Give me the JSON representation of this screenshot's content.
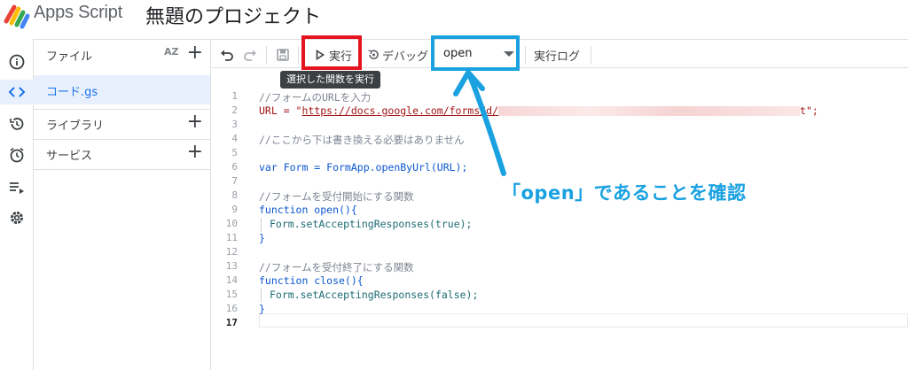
{
  "app": {
    "name": "Apps Script",
    "project_title": "無題のプロジェクト"
  },
  "sidebar": {
    "files_label": "ファイル",
    "sort_label": "AZ",
    "file_name": "コード.gs",
    "libraries_label": "ライブラリ",
    "services_label": "サービス",
    "add_symbol": "+"
  },
  "toolbar": {
    "run_label": "実行",
    "debug_label": "デバッグ",
    "function_select": "open",
    "log_label": "実行ログ",
    "tooltip": "選択した関数を実行"
  },
  "editor": {
    "line_numbers": [
      "1",
      "2",
      "3",
      "4",
      "5",
      "6",
      "7",
      "8",
      "9",
      "10",
      "11",
      "12",
      "13",
      "14",
      "15",
      "16",
      "17"
    ],
    "current_line": "17",
    "line1": "//フォームのURLを入力",
    "line2_prefix": "URL = \"",
    "line2_url": "https://docs.google.com/forms/d/",
    "line2_suffix": "t\";",
    "line4": "//ここから下は書き換える必要はありません",
    "line6": "var Form = FormApp.openByUrl(URL);",
    "line8": "//フォームを受付開始にする関数",
    "line9": "function open(){",
    "line10": "Form.setAcceptingResponses(true);",
    "line11": "}",
    "line13": "//フォームを受付終了にする関数",
    "line14": "function close(){",
    "line15": "Form.setAcceptingResponses(false);",
    "line16": "}"
  },
  "annotation": {
    "text": "「open」であることを確認"
  },
  "colors": {
    "red_highlight": "#e5141f",
    "blue_highlight": "#1aa1e0",
    "accent": "#1a73e8"
  },
  "icons": [
    "info-icon",
    "code-icon",
    "history-icon",
    "alarm-icon",
    "executions-icon",
    "settings-icon",
    "undo-icon",
    "redo-icon",
    "save-icon",
    "play-icon",
    "debug-icon"
  ]
}
